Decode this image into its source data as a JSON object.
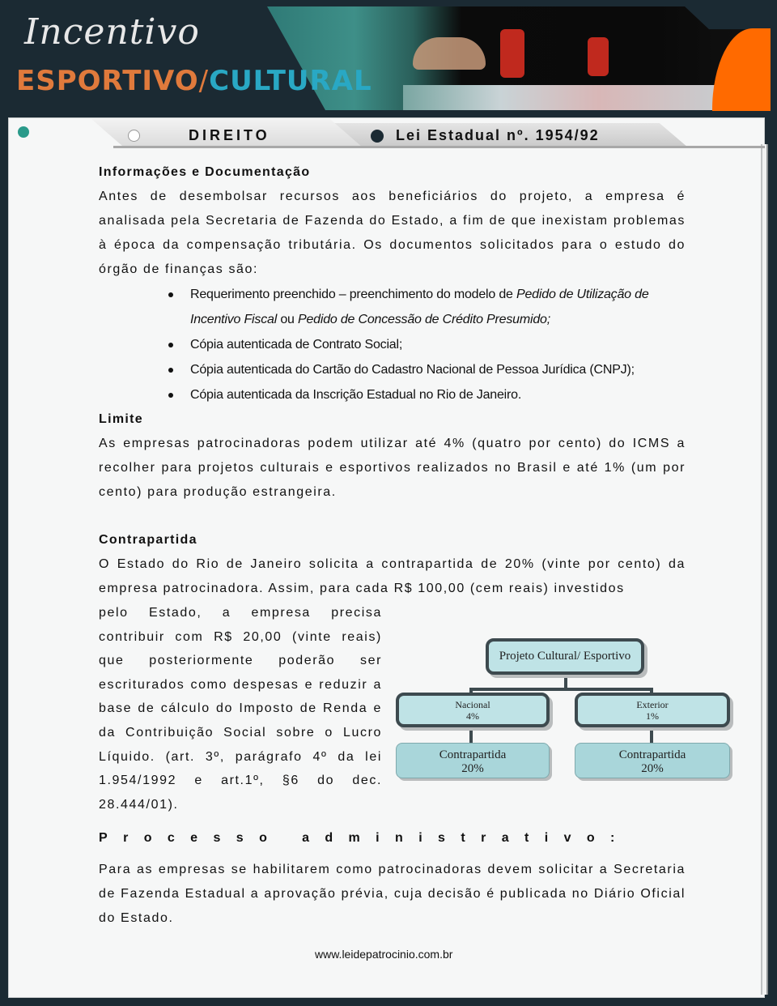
{
  "header": {
    "logo_script": "Incentivo",
    "logo_orange": "ESPORTIVO",
    "logo_slash": "/",
    "logo_cyan": "CULTURAL",
    "colors": {
      "orange": "#e07a3c",
      "cyan": "#29a8c4",
      "background": "#1b2a33",
      "accent_orange": "#ff6a00"
    }
  },
  "tabs": [
    {
      "label": "DIREITO"
    },
    {
      "label": "Lei Estadual nº. 1954/92"
    }
  ],
  "sections": {
    "info": {
      "heading": "Informações e Documentação",
      "paragraph": "Antes de desembolsar recursos aos beneficiários do projeto, a empresa é analisada pela Secretaria de Fazenda do Estado, a fim de que inexistam problemas à época da compensação tributária. Os documentos solicitados para o estudo do órgão de finanças são:",
      "documents": [
        {
          "text_a": "Requerimento preenchido – preenchimento do modelo de ",
          "italic_a": "Pedido de Utilização de Incentivo Fiscal",
          "text_b": " ou ",
          "italic_b": "Pedido de Concessão de Crédito Presumido;"
        },
        {
          "text": "Cópia autenticada de Contrato Social;"
        },
        {
          "text": "Cópia autenticada do Cartão do Cadastro Nacional de Pessoa Jurídica (CNPJ);"
        },
        {
          "text": "Cópia autenticada da Inscrição Estadual no Rio de Janeiro."
        }
      ]
    },
    "limite": {
      "heading": "Limite",
      "paragraph": "As empresas patrocinadoras podem utilizar até 4% (quatro por cento) do ICMS a recolher para projetos culturais e esportivos realizados no Brasil e até 1% (um por cento) para produção estrangeira."
    },
    "contrapartida": {
      "heading": "Contrapartida",
      "paragraph_full": "O Estado do Rio de Janeiro solicita a contrapartida de 20% (vinte por cento) da empresa patrocinadora. Assim, para cada R$ 100,00 (cem reais) investidos",
      "paragraph_narrow": "pelo Estado, a empresa precisa contribuir com R$ 20,00 (vinte reais) que posteriormente poderão ser escriturados como despesas e reduzir a base de cálculo do Imposto de Renda e da Contribuição Social sobre o Lucro Líquido. (art. 3º, parágrafo 4º da lei 1.954/1992 e art.1º, §6 do dec.",
      "paragraph_last": "28.444/01)."
    },
    "processo": {
      "heading": "Processo administrativo:",
      "paragraph": "Para as empresas se habilitarem como patrocinadoras devem solicitar a Secretaria de Fazenda Estadual a aprovação prévia, cuja decisão é publicada no Diário Oficial do Estado."
    }
  },
  "diagram": {
    "root": "Projeto Cultural/ Esportivo",
    "branches": [
      {
        "name": "Nacional",
        "value": "4%",
        "child_label": "Contrapartida",
        "child_value": "20%"
      },
      {
        "name": "Exterior",
        "value": "1%",
        "child_label": "Contrapartida",
        "child_value": "20%"
      }
    ]
  },
  "footer": {
    "url": "www.leidepatrocinio.com.br"
  }
}
